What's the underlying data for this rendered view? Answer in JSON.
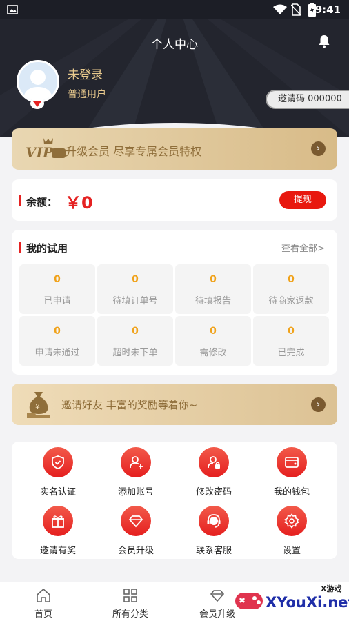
{
  "status_bar": {
    "time": "9:41"
  },
  "header": {
    "title": "个人中心"
  },
  "user": {
    "name": "未登录",
    "level": "普通用户",
    "invite_code": "邀请码 000000"
  },
  "vip_banner": {
    "text": "升级会员 尽享专属会员特权",
    "logo_text": "VIP会员",
    "arrow": "›"
  },
  "balance": {
    "label": "余额：",
    "value": "￥0",
    "withdraw": "提现"
  },
  "trials": {
    "title": "我的试用",
    "view_all": "查看全部>",
    "items": [
      {
        "count": "0",
        "label": "已申请"
      },
      {
        "count": "0",
        "label": "待填订单号"
      },
      {
        "count": "0",
        "label": "待填报告"
      },
      {
        "count": "0",
        "label": "待商家返款"
      },
      {
        "count": "0",
        "label": "申请未通过"
      },
      {
        "count": "0",
        "label": "超时未下单"
      },
      {
        "count": "0",
        "label": "需修改"
      },
      {
        "count": "0",
        "label": "已完成"
      }
    ]
  },
  "invite_banner": {
    "text": "邀请好友 丰富的奖励等着你~",
    "arrow": "›"
  },
  "services": [
    {
      "label": "实名认证",
      "icon": "shield-icon"
    },
    {
      "label": "添加账号",
      "icon": "add-user-icon"
    },
    {
      "label": "修改密码",
      "icon": "user-lock-icon"
    },
    {
      "label": "我的钱包",
      "icon": "wallet-icon"
    },
    {
      "label": "邀请有奖",
      "icon": "gift-icon"
    },
    {
      "label": "会员升级",
      "icon": "diamond-icon"
    },
    {
      "label": "联系客服",
      "icon": "headset-icon"
    },
    {
      "label": "设置",
      "icon": "gear-icon"
    }
  ],
  "tabs": [
    {
      "label": "首页",
      "icon": "home-icon"
    },
    {
      "label": "所有分类",
      "icon": "grid-icon"
    },
    {
      "label": "会员升级",
      "icon": "diamond-icon"
    }
  ],
  "watermark": {
    "small": "X游戏",
    "big": "XYouXi.net"
  },
  "colors": {
    "accent": "#e52222",
    "gold": "#e8c98d",
    "header_bg": "#23252e",
    "count": "#f0a21a"
  }
}
